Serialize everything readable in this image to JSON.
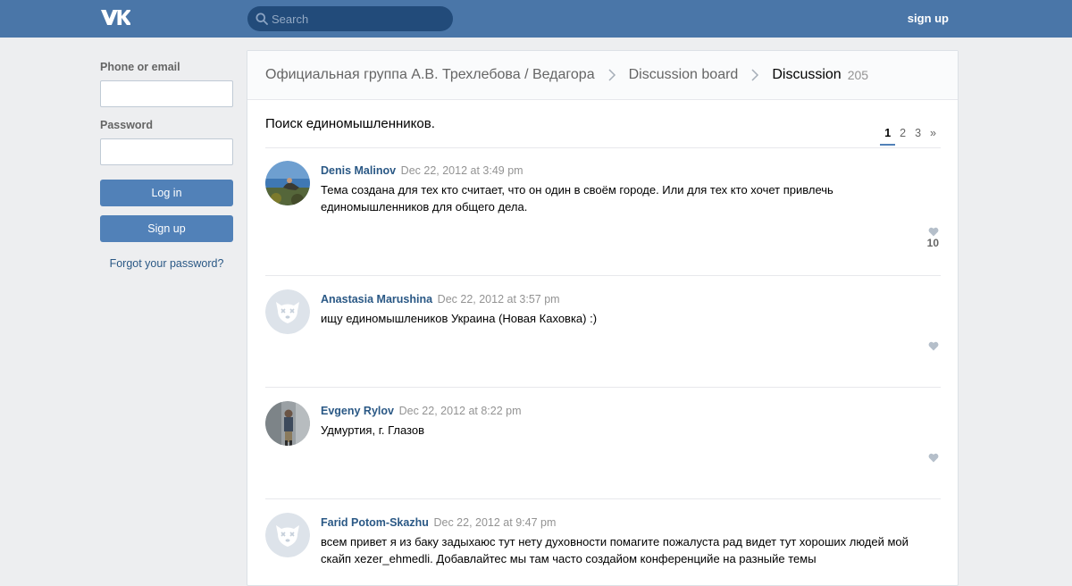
{
  "header": {
    "logo": "vk-logo",
    "search_placeholder": "Search",
    "signup_label": "sign up"
  },
  "login": {
    "phone_label": "Phone or email",
    "phone_value": "",
    "password_label": "Password",
    "password_value": "",
    "login_button": "Log in",
    "signup_button": "Sign up",
    "forgot_link": "Forgot your password?"
  },
  "breadcrumb": {
    "group": "Официальная группа А.В. Трехлебова / Ведагора",
    "board": "Discussion board",
    "current": "Discussion",
    "count": "205"
  },
  "topic": {
    "title": "Поиск единомышленников."
  },
  "pagination": {
    "pages": [
      "1",
      "2",
      "3"
    ],
    "next": "»",
    "current": "1"
  },
  "posts": [
    {
      "author": "Denis Malinov",
      "date": "Dec 22, 2012 at 3:49 pm",
      "text": "Тема создана для тех кто считает, что он один в своём городе. Или для тех кто хочет привлечь единомышленников для общего дела.",
      "likes": "10",
      "avatar": "photo"
    },
    {
      "author": "Anastasia Marushina",
      "date": "Dec 22, 2012 at 3:57 pm",
      "text": "ищу единомышлеников Украина (Новая Каховка) :)",
      "likes": "",
      "avatar": "default"
    },
    {
      "author": "Evgeny Rylov",
      "date": "Dec 22, 2012 at 8:22 pm",
      "text": "Удмуртия, г. Глазов",
      "likes": "",
      "avatar": "photo"
    },
    {
      "author": "Farid Potom-Skazhu",
      "date": "Dec 22, 2012 at 9:47 pm",
      "text": "всем привет я из баку задыхаюс тут нету духовности помагите пожалуста рад видет тут хороших людей мой скайп xezer_ehmedli. Добавлайтес мы там часто создайом конференцийе на разныйе темы",
      "likes": "",
      "avatar": "default"
    }
  ],
  "colors": {
    "topbar": "#4a76a8",
    "accent": "#5181b8",
    "link": "#2a5885",
    "page_bg": "#edeef0"
  }
}
